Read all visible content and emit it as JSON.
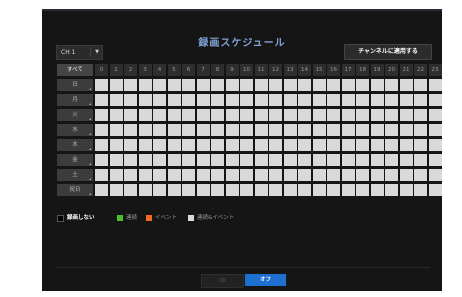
{
  "dialog": {
    "title": "録画スケジュール",
    "channel_select": {
      "value": "CH 1"
    },
    "apply_button": "チャンネルに適用する",
    "ok_button": "OK",
    "off_button": "オフ"
  },
  "grid": {
    "all_label": "すべて",
    "hours": [
      "0",
      "1",
      "2",
      "3",
      "4",
      "5",
      "6",
      "7",
      "8",
      "9",
      "10",
      "11",
      "12",
      "13",
      "14",
      "15",
      "16",
      "17",
      "18",
      "19",
      "20",
      "21",
      "22",
      "23"
    ],
    "days": [
      "日",
      "月",
      "火",
      "水",
      "木",
      "金",
      "土",
      "祝日"
    ]
  },
  "legend": {
    "none": "録画しない",
    "continuous": "連続",
    "event": "イベント",
    "both": "連続&イベント"
  },
  "colors": {
    "continuous": "#4bbf2a",
    "event": "#f26b1d",
    "both": "#d9d9d9",
    "none": "#000000",
    "accent": "#1e6fd2"
  }
}
